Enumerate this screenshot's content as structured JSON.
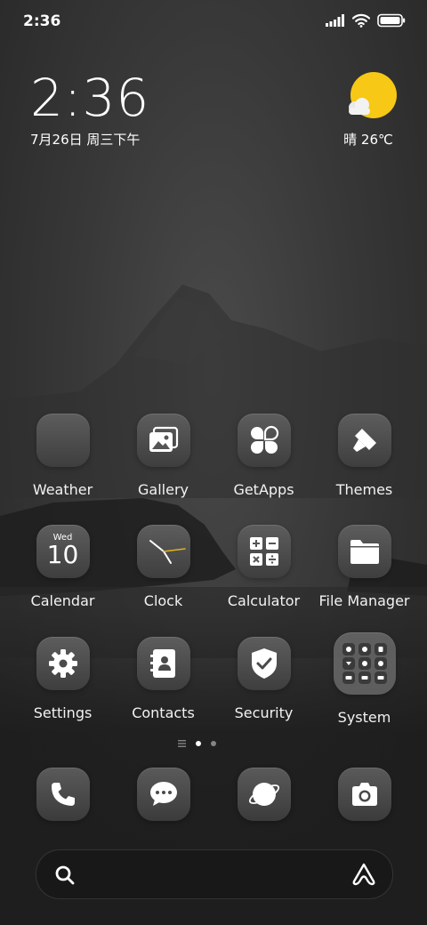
{
  "status_bar": {
    "time": "2:36"
  },
  "clock_widget": {
    "time": "2:36",
    "date": "7月26日 周三下午"
  },
  "weather_widget": {
    "condition": "晴",
    "temperature": "晴 26℃",
    "icon": "sun-cloud-icon"
  },
  "apps": [
    {
      "label": "Weather",
      "icon": "weather-icon"
    },
    {
      "label": "Gallery",
      "icon": "gallery-icon"
    },
    {
      "label": "GetApps",
      "icon": "getapps-icon"
    },
    {
      "label": "Themes",
      "icon": "brush-icon"
    },
    {
      "label": "Calendar",
      "icon": "calendar-icon",
      "day_name": "Wed",
      "day_number": "10"
    },
    {
      "label": "Clock",
      "icon": "clock-icon"
    },
    {
      "label": "Calculator",
      "icon": "calculator-icon"
    },
    {
      "label": "File Manager",
      "icon": "folder-icon"
    },
    {
      "label": "Settings",
      "icon": "gear-icon"
    },
    {
      "label": "Contacts",
      "icon": "contacts-icon"
    },
    {
      "label": "Security",
      "icon": "shield-icon"
    },
    {
      "label": "System",
      "icon": "system-folder-icon"
    }
  ],
  "page_indicator": {
    "total_dots": 2,
    "active_index": 0
  },
  "dock": [
    {
      "name": "phone",
      "icon": "phone-icon"
    },
    {
      "name": "messages",
      "icon": "message-icon"
    },
    {
      "name": "browser",
      "icon": "planet-icon"
    },
    {
      "name": "camera",
      "icon": "camera-icon"
    }
  ],
  "search_bar": {
    "icon": "search-icon",
    "assistant_icon": "assistant-icon"
  },
  "colors": {
    "sun": "#f7c815",
    "clock_hand_accent": "#e3b21b",
    "text": "#ffffff"
  }
}
